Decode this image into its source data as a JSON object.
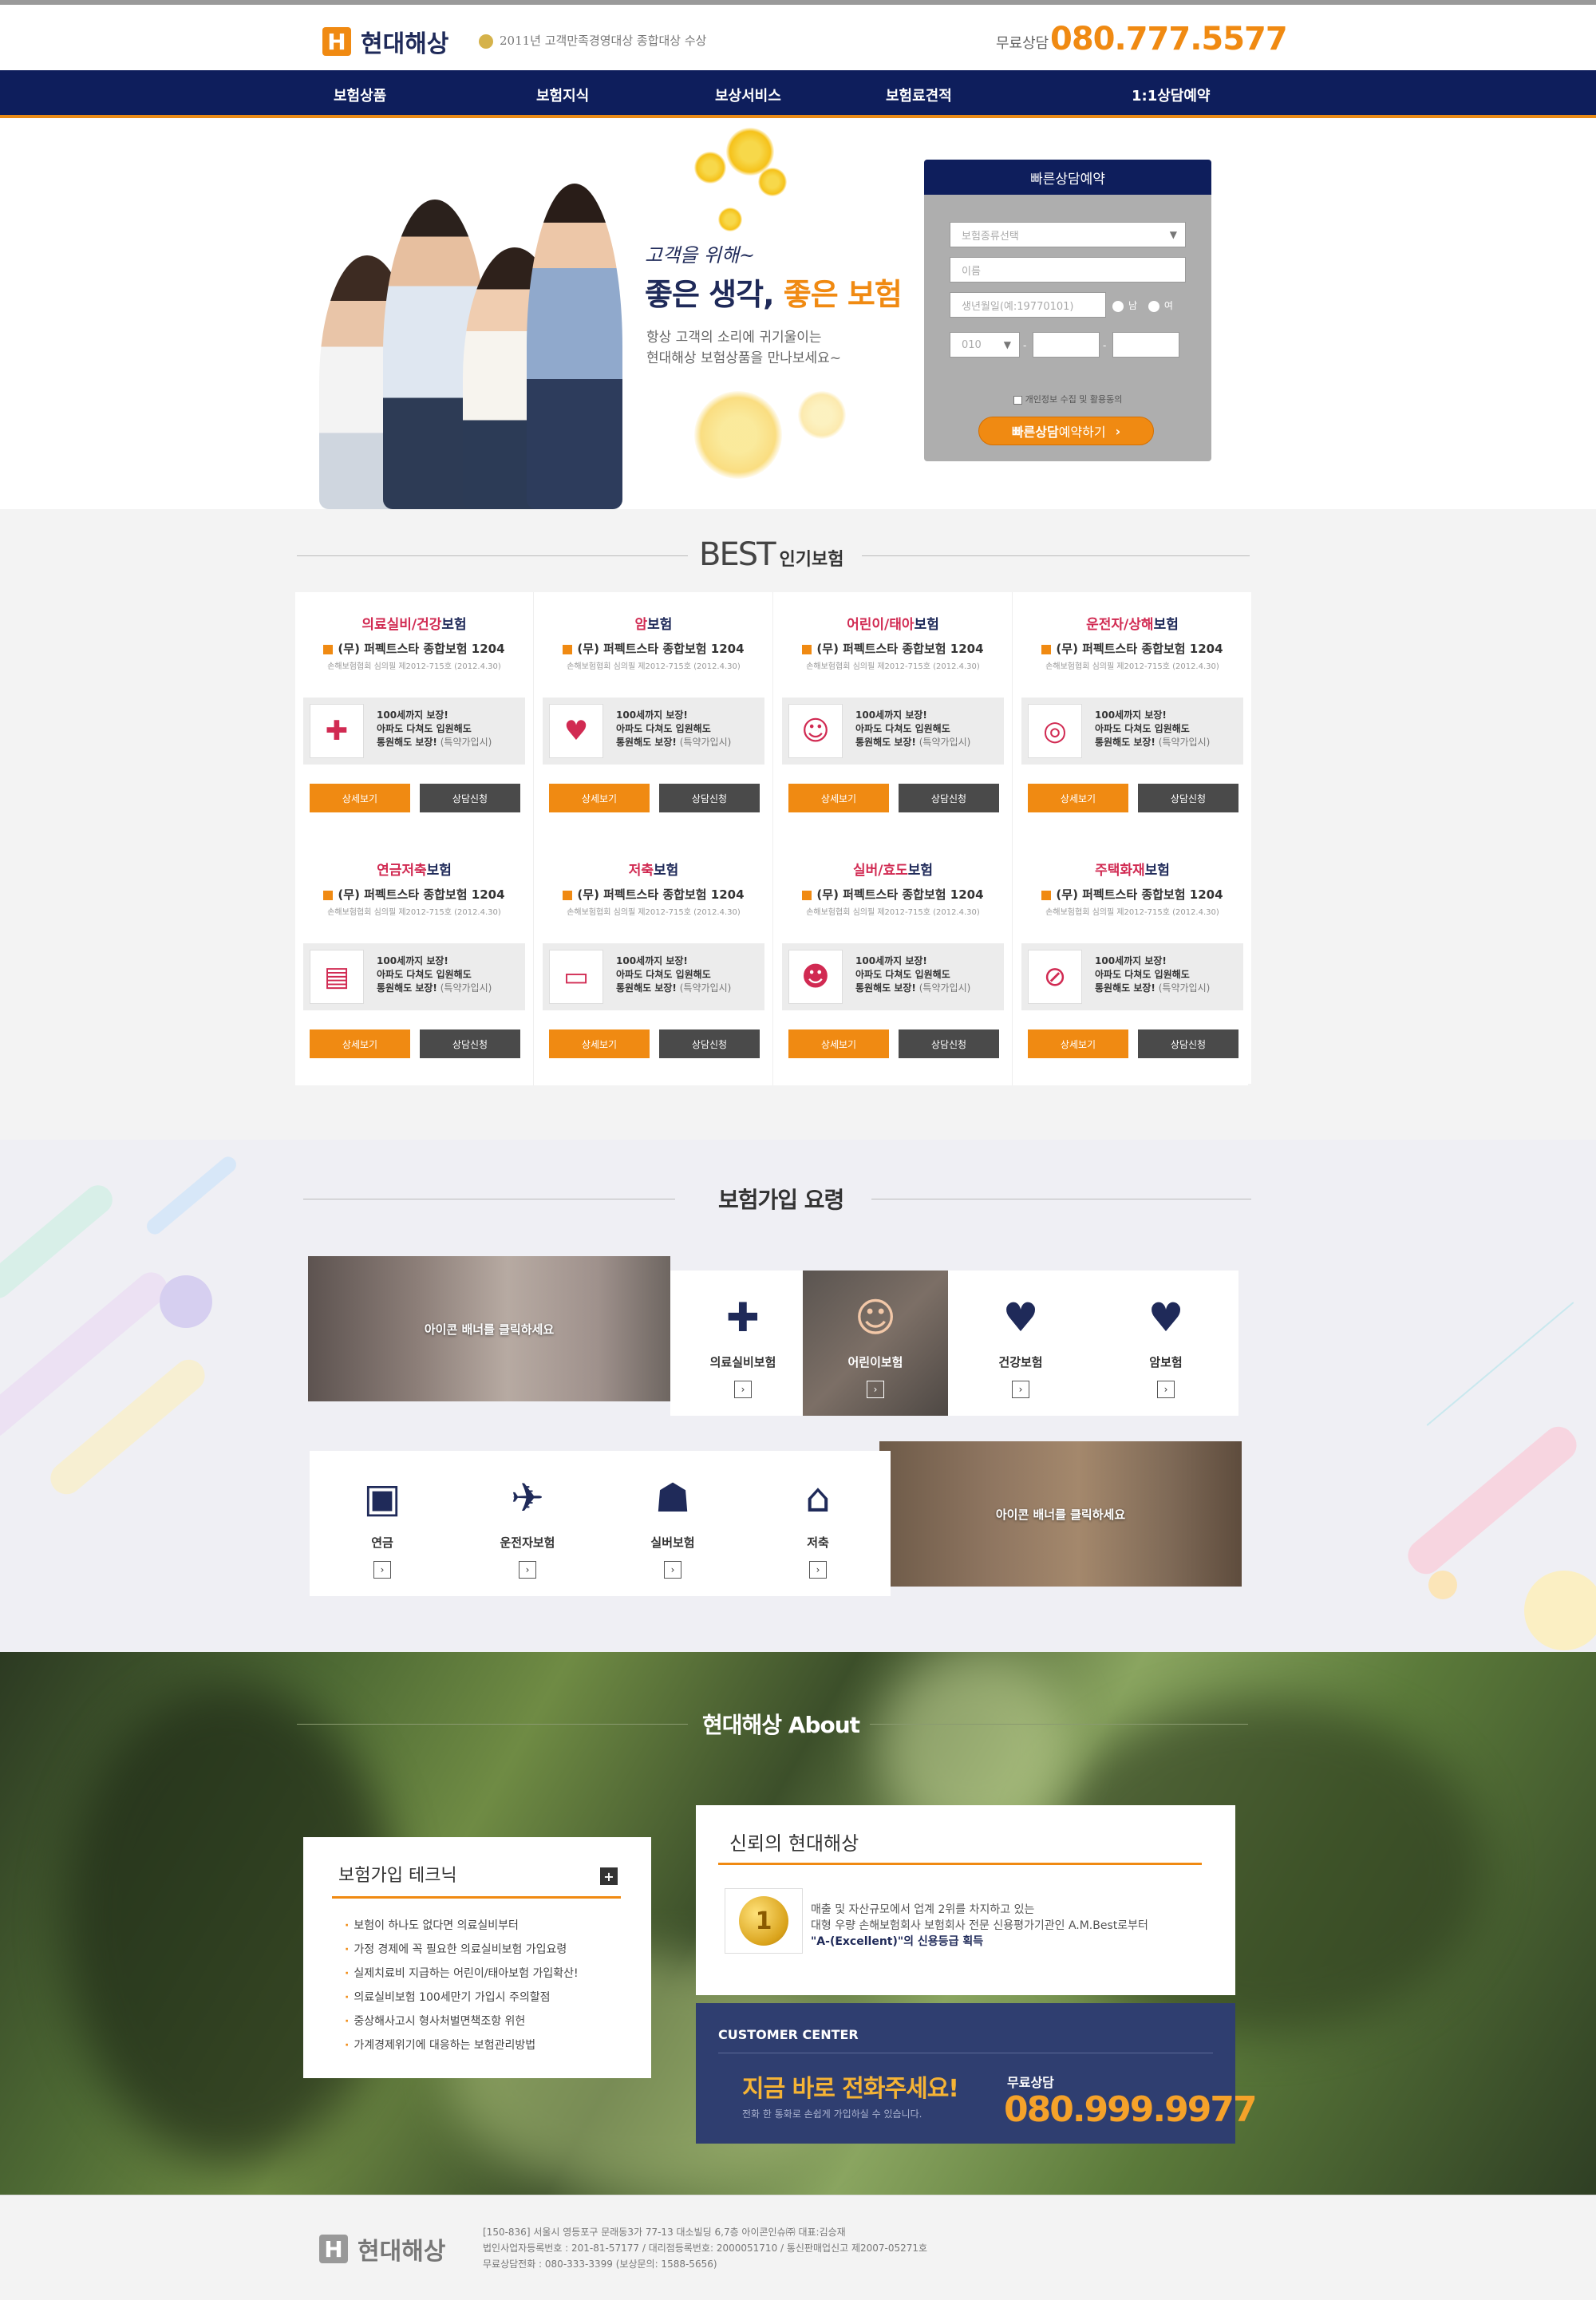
{
  "header": {
    "logo_mark": "H",
    "logo_text": "현대해상",
    "award": "2011년 고객만족경영대상 종합대상 수상",
    "free_label": "무료상담",
    "phone": "080.777.5577"
  },
  "nav": {
    "items": [
      "보험상품",
      "보험지식",
      "보상서비스",
      "보험료견적",
      "1:1상담예약"
    ]
  },
  "hero": {
    "small": "고객을 위해~",
    "big_a": "좋은 생각, ",
    "big_b": "좋은 보험",
    "desc_1": "항상 고객의 소리에 귀기울이는",
    "desc_2": "현대해상 보험상품을 만나보세요~"
  },
  "quick": {
    "title": "빠른상담예약",
    "type_placeholder": "보험종류선택",
    "name_placeholder": "이름",
    "birth_placeholder": "생년월일(예:19770101)",
    "male": "남",
    "female": "여",
    "phone_prefix": "010",
    "agree": "개인정보 수집 및 활용동의",
    "button_a": "빠른상담",
    "button_b": " 예약하기"
  },
  "best": {
    "title": "BEST",
    "subtitle": "인기보험",
    "detail_label": "상세보기",
    "consult_label": "상담신청",
    "product": "(무) 퍼펙트스타 종합보험 1204",
    "reg": "손해보험협회 심의필 제2012-715호 (2012.4.30)",
    "text_1": "100세까지 보장!",
    "text_2": "아파도 다쳐도 입원해도",
    "text_3": "통원해도 보장!",
    "text_3b": " (특약가입시)",
    "cards": [
      {
        "title_a": "의료실비/건강",
        "title_b": "보험",
        "icon": "medical-hand-icon",
        "glyph": "✚"
      },
      {
        "title_a": "암",
        "title_b": "보험",
        "icon": "heart-icon",
        "glyph": "♥"
      },
      {
        "title_a": "어린이/태아",
        "title_b": "보험",
        "icon": "child-face-icon",
        "glyph": "☺"
      },
      {
        "title_a": "운전자/상해",
        "title_b": "보험",
        "icon": "steering-wheel-icon",
        "glyph": "◎"
      },
      {
        "title_a": "연금저축",
        "title_b": "보험",
        "icon": "money-icon",
        "glyph": "▤"
      },
      {
        "title_a": "저축",
        "title_b": "보험",
        "icon": "savings-laptop-icon",
        "glyph": "▭"
      },
      {
        "title_a": "실버/효도",
        "title_b": "보험",
        "icon": "elder-face-icon",
        "glyph": "☻"
      },
      {
        "title_a": "주택화재",
        "title_b": "보험",
        "icon": "fire-icon",
        "glyph": "⊘"
      }
    ]
  },
  "join": {
    "title": "보험가입 요령",
    "banner_top": "아이콘 배너를 클릭하세요",
    "banner_bottom": "아이콘 배너를 클릭하세요",
    "tiles_top": [
      {
        "label": "의료실비보험",
        "icon": "medical-kit-icon",
        "glyph": "✚"
      },
      {
        "label": "어린이보험",
        "icon": "child-photo-icon",
        "glyph": "☺"
      },
      {
        "label": "건강보험",
        "icon": "heart-hand-icon",
        "glyph": "♥"
      },
      {
        "label": "암보험",
        "icon": "heartbeat-icon",
        "glyph": "♥"
      }
    ],
    "tiles_bottom": [
      {
        "label": "연금",
        "icon": "money-hand-icon",
        "glyph": "▣"
      },
      {
        "label": "운전자보험",
        "icon": "car-crash-icon",
        "glyph": "✈"
      },
      {
        "label": "실버보험",
        "icon": "person-shield-icon",
        "glyph": "☗"
      },
      {
        "label": "저축",
        "icon": "house-money-icon",
        "glyph": "⌂"
      }
    ],
    "arrow": "›"
  },
  "about": {
    "title": "현대해상 About",
    "tech_title": "보험가입 테크닉",
    "tech_plus": "+",
    "tech_items": [
      "보험이 하나도 없다면 의료실비부터",
      "가정 경제에 꼭 필요한 의료실비보험 가입요령",
      "실제치료비 지급하는 어린이/태아보험 가입확산!",
      "의료실비보험 100세만기 가입시 주의할점",
      "중상해사고시 형사처벌면책조항 위헌",
      "가계경제위기에 대응하는 보험관리방법"
    ],
    "trust_title": "신뢰의 현대해상",
    "trust_coin": "1",
    "trust_1": "매출 및 자산규모에서 업계 2위를 차지하고 있는",
    "trust_2": "대형 우량 손해보험회사 보험회사 전문 신용평가기관인 A.M.Best로부터",
    "trust_3": "\"A-(Excellent)\"의 신용등급 획득",
    "cc_title": "CUSTOMER CENTER",
    "cc_call": "지금 바로 전화주세요!",
    "cc_sub": "전화 한 통화로 손쉽게 가입하실 수 있습니다.",
    "cc_free": "무료상담",
    "cc_phone": "080.999.9977"
  },
  "footer": {
    "logo_mark": "H",
    "logo_text": "현대해상",
    "line_1": "[150-836] 서울시 영등포구 문래동3가 77-13 대소빌딩 6,7층 아이콘인슈㈜ 대표:김승재",
    "line_2": "법인사업자등록번호 : 201-81-57177 / 대리점등록번호: 2000051710 / 통신판매업신고 제2007-05271호",
    "line_3": "무료상담전화 : 080-333-3399 (보상문의: 1588-5656)"
  }
}
